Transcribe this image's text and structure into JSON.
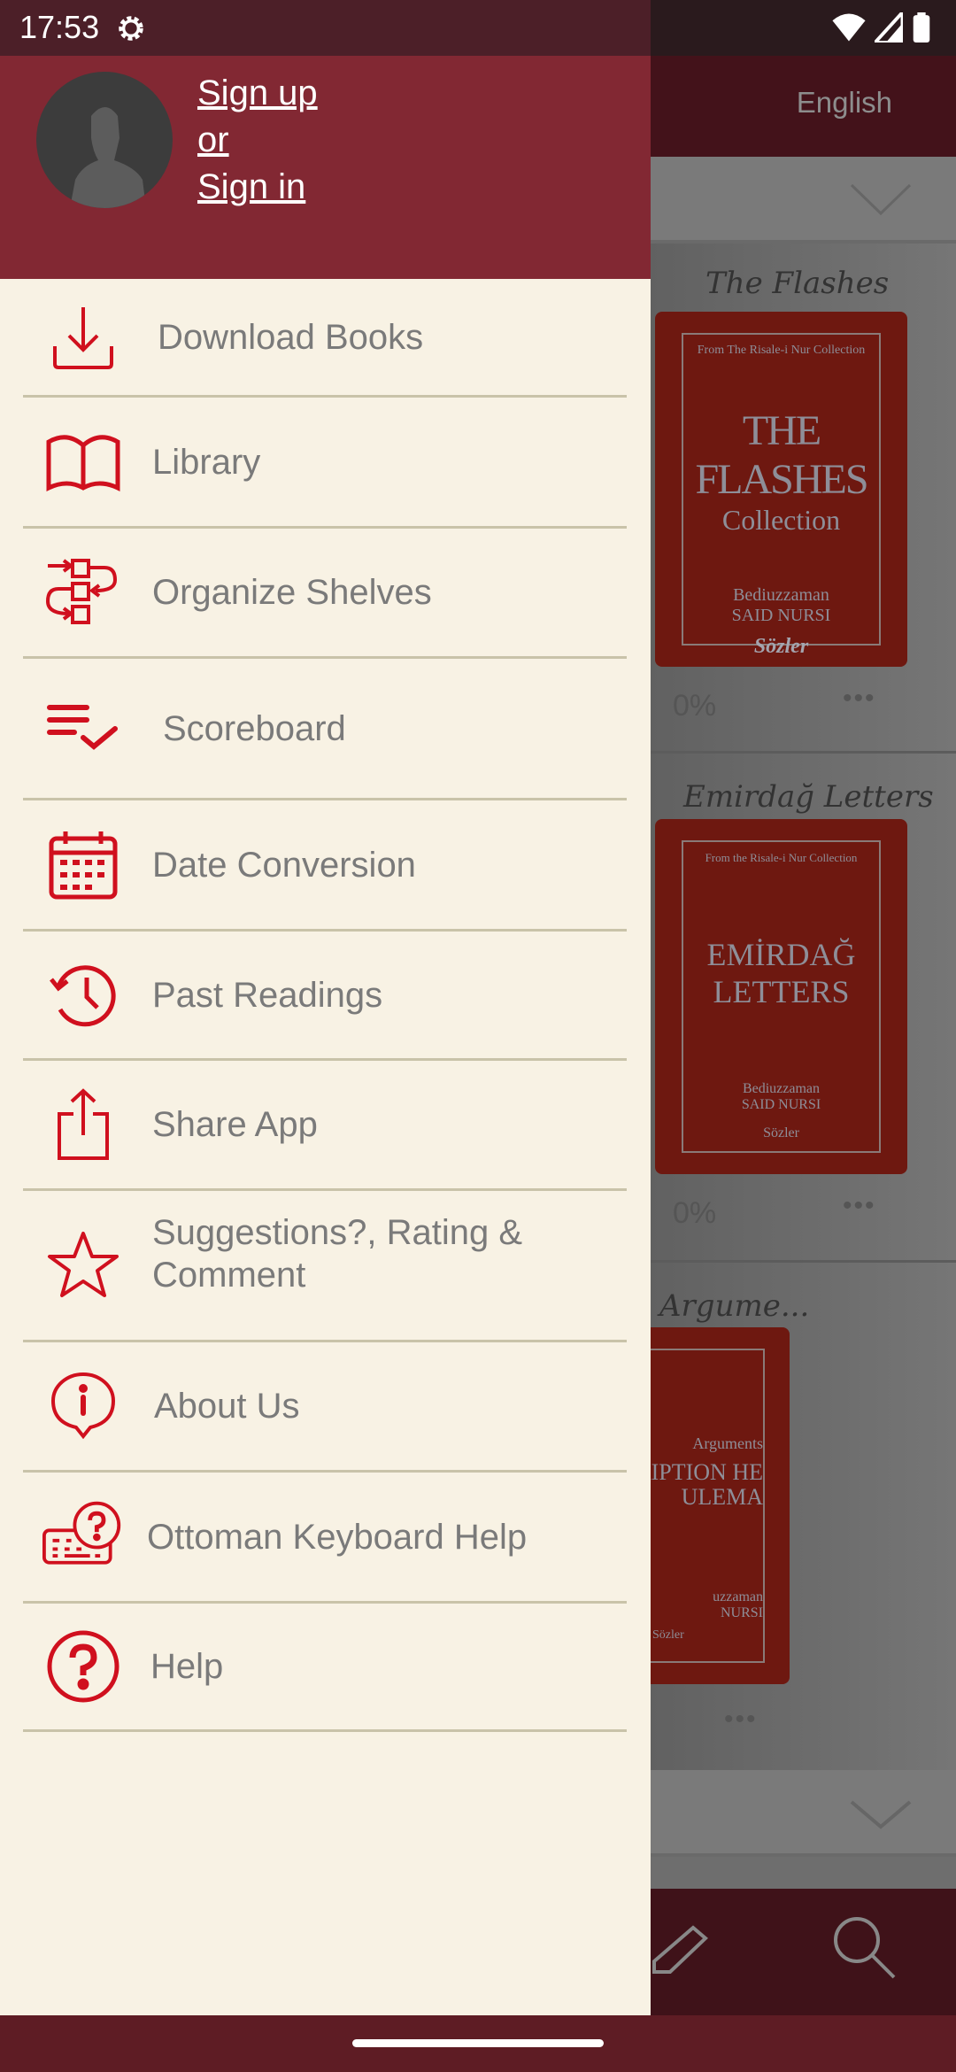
{
  "status_bar": {
    "time": "17:53"
  },
  "background": {
    "language": "English",
    "books": [
      {
        "title": "The Flashes",
        "cover_top": "From The Risale-i Nur Collection",
        "cover_main": "THE FLASHES",
        "cover_sub": "Collection",
        "author1": "Bediuzzaman",
        "author2": "SAID NURSI",
        "publisher": "Sözler",
        "progress": "0%"
      },
      {
        "title": "Emirdağ Letters",
        "cover_top": "From the Risale-i Nur Collection",
        "cover_main": "EMİRDAĞ LETTERS",
        "author1": "Bediuzzaman",
        "author2": "SAID NURSI",
        "publisher": "Sözler",
        "progress": "0%"
      },
      {
        "title": "Argume...",
        "cover_top": "Arguments",
        "cover_main": "CRIPTION HE ULEMA",
        "author1": "uzzaman",
        "author2": "NURSI",
        "publisher": "Sözler"
      }
    ],
    "more": "•••"
  },
  "drawer": {
    "sign_up": "Sign up",
    "or": "or",
    "sign_in": "Sign in",
    "items": [
      {
        "label": "Download Books",
        "icon": "download-icon"
      },
      {
        "label": "Library",
        "icon": "book-open-icon"
      },
      {
        "label": "Organize Shelves",
        "icon": "organize-icon"
      },
      {
        "label": "Scoreboard",
        "icon": "checklist-icon"
      },
      {
        "label": "Date Conversion",
        "icon": "calendar-icon"
      },
      {
        "label": "Past Readings",
        "icon": "history-icon"
      },
      {
        "label": "Share App",
        "icon": "share-icon"
      },
      {
        "label": "Suggestions?, Rating & Comment",
        "icon": "star-icon"
      },
      {
        "label": "About Us",
        "icon": "info-icon"
      },
      {
        "label": "Ottoman Keyboard Help",
        "icon": "keyboard-help-icon"
      },
      {
        "label": "Help",
        "icon": "help-icon"
      }
    ]
  },
  "colors": {
    "accent": "#d0101e",
    "header": "#822833",
    "drawer_bg": "#f8f2e4",
    "text": "#7a7a7a"
  }
}
